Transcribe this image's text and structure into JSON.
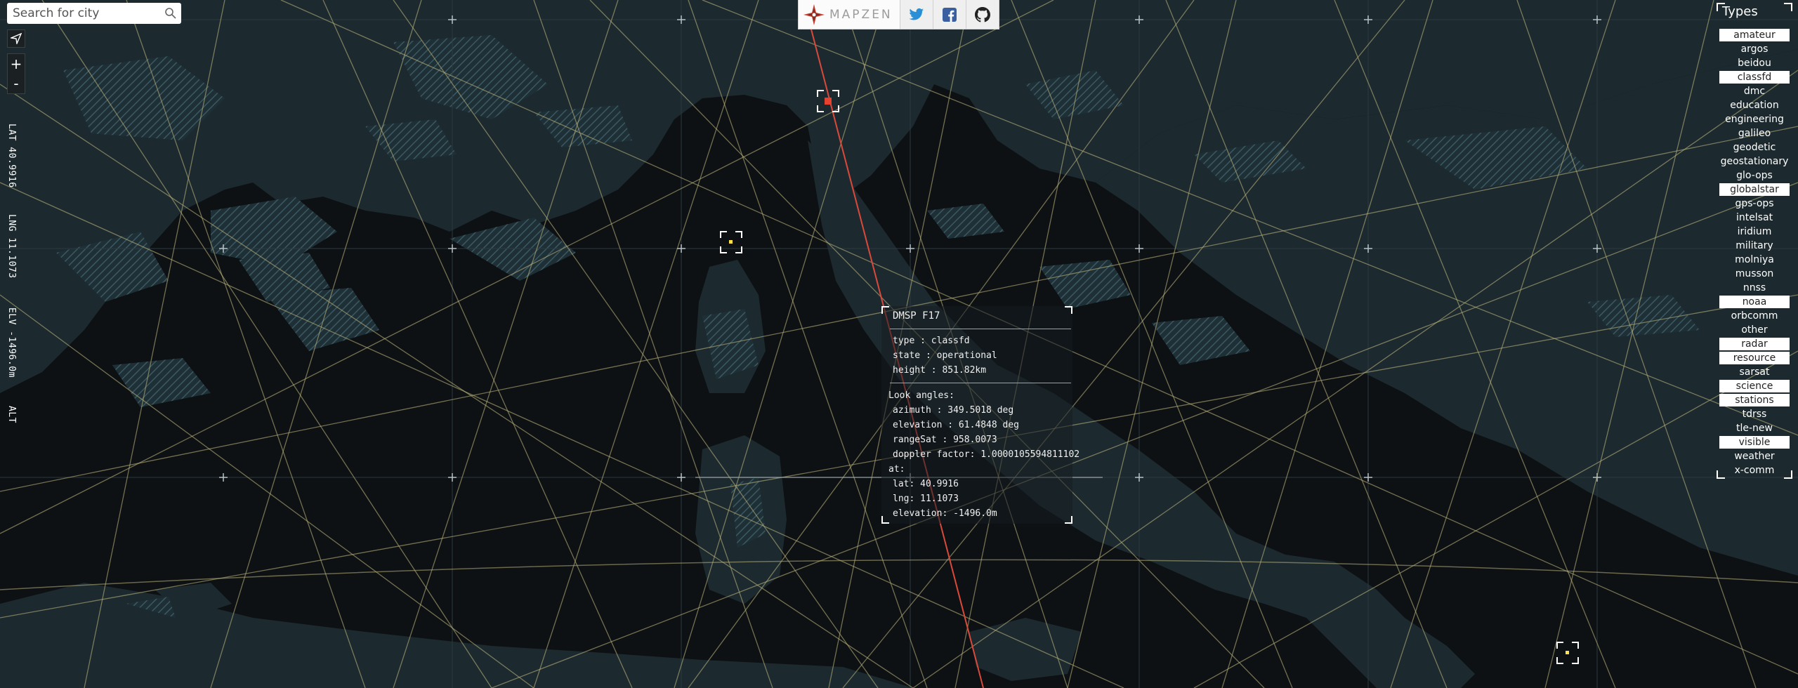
{
  "search": {
    "placeholder": "Search for city"
  },
  "coords": {
    "lat": "LAT 40.9916",
    "lng": "LNG 11.1073",
    "elv": "ELV -1496.0m",
    "alt": "ALT"
  },
  "zoom": {
    "in_label": "+",
    "out_label": "-"
  },
  "brand": {
    "name": "MAPZEN"
  },
  "colors": {
    "map_bg": "#0d1114",
    "land": "#1d2a30",
    "orbit": "#c9c08a",
    "selected_orbit": "#d94a3a",
    "selected_marker": "#e8412f",
    "marker": "#ffe14a"
  },
  "types": {
    "title": "Types",
    "items": [
      {
        "label": "amateur",
        "on": true
      },
      {
        "label": "argos",
        "on": false
      },
      {
        "label": "beidou",
        "on": false
      },
      {
        "label": "classfd",
        "on": true
      },
      {
        "label": "dmc",
        "on": false
      },
      {
        "label": "education",
        "on": false
      },
      {
        "label": "engineering",
        "on": false
      },
      {
        "label": "galileo",
        "on": false
      },
      {
        "label": "geodetic",
        "on": false
      },
      {
        "label": "geostationary",
        "on": false
      },
      {
        "label": "glo-ops",
        "on": false
      },
      {
        "label": "globalstar",
        "on": true
      },
      {
        "label": "gps-ops",
        "on": false
      },
      {
        "label": "intelsat",
        "on": false
      },
      {
        "label": "iridium",
        "on": false
      },
      {
        "label": "military",
        "on": false
      },
      {
        "label": "molniya",
        "on": false
      },
      {
        "label": "musson",
        "on": false
      },
      {
        "label": "nnss",
        "on": false
      },
      {
        "label": "noaa",
        "on": true
      },
      {
        "label": "orbcomm",
        "on": false
      },
      {
        "label": "other",
        "on": false
      },
      {
        "label": "radar",
        "on": true
      },
      {
        "label": "resource",
        "on": true
      },
      {
        "label": "sarsat",
        "on": false
      },
      {
        "label": "science",
        "on": true
      },
      {
        "label": "stations",
        "on": true
      },
      {
        "label": "tdrss",
        "on": false
      },
      {
        "label": "tle-new",
        "on": false
      },
      {
        "label": "visible",
        "on": true
      },
      {
        "label": "weather",
        "on": false
      },
      {
        "label": "x-comm",
        "on": false
      }
    ]
  },
  "info": {
    "name": "DMSP F17",
    "type": "type : classfd",
    "state": "state : operational",
    "height": "height : 851.82km",
    "look_title": "Look angles:",
    "azimuth": "azimuth : 349.5018 deg",
    "elevation": "elevation : 61.4848 deg",
    "range": "rangeSat : 958.0073",
    "doppler": "doppler factor: 1.0000105594811102",
    "at": "at:",
    "lat": "lat: 40.9916",
    "lng": "lng: 11.1073",
    "elv": "elevation: -1496.0m"
  }
}
